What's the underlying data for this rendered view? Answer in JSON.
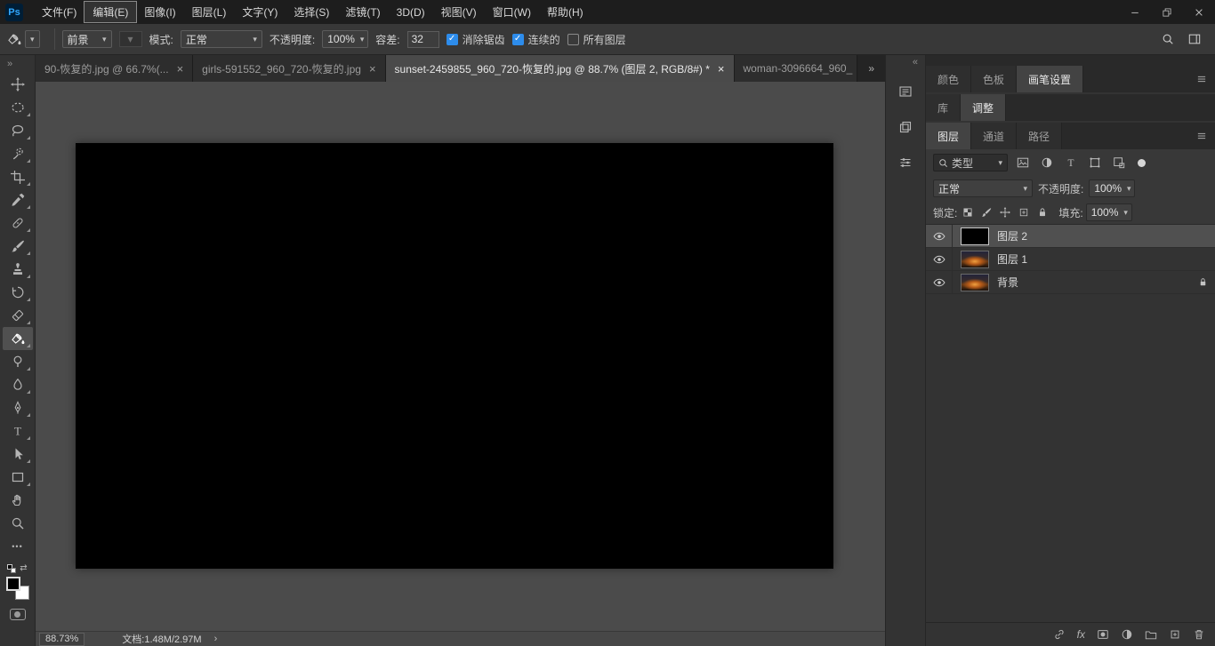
{
  "window": {
    "logo": "Ps"
  },
  "glyphs": {
    "close": "×",
    "chevron_down": "▾",
    "overflow_right": "»",
    "collapse_left": "«",
    "status_chevron": "›",
    "check": "✓",
    "ellipsis": "•••",
    "swap": "⇄"
  },
  "menu_bar": {
    "items": [
      "文件(F)",
      "编辑(E)",
      "图像(I)",
      "图层(L)",
      "文字(Y)",
      "选择(S)",
      "滤镜(T)",
      "3D(D)",
      "视图(V)",
      "窗口(W)",
      "帮助(H)"
    ]
  },
  "options_bar": {
    "tool": "paint-bucket-tool",
    "foreground_source": "前景",
    "mode_label": "模式:",
    "mode_value": "正常",
    "opacity_label": "不透明度:",
    "opacity_value": "100%",
    "tolerance_label": "容差:",
    "tolerance_value": "32",
    "anti_alias_label": "消除锯齿",
    "anti_alias_checked": true,
    "contiguous_label": "连续的",
    "contiguous_checked": true,
    "all_layers_label": "所有图层",
    "all_layers_checked": false
  },
  "document_tabs": [
    {
      "title": "90-恢复的.jpg @ 66.7%(...",
      "active": false
    },
    {
      "title": "girls-591552_960_720-恢复的.jpg",
      "active": false
    },
    {
      "title": "sunset-2459855_960_720-恢复的.jpg @ 88.7% (图层 2, RGB/8#) *",
      "active": true
    },
    {
      "title": "woman-3096664_960_",
      "active": false
    }
  ],
  "toolbar_tools": [
    {
      "name": "move-tool",
      "selected": false
    },
    {
      "name": "elliptical-marquee-tool",
      "selected": false
    },
    {
      "name": "lasso-tool",
      "selected": false
    },
    {
      "name": "quick-selection-tool",
      "selected": false
    },
    {
      "name": "crop-tool",
      "selected": false
    },
    {
      "name": "eyedropper-tool",
      "selected": false
    },
    {
      "name": "spot-healing-brush-tool",
      "selected": false
    },
    {
      "name": "brush-tool",
      "selected": false
    },
    {
      "name": "clone-stamp-tool",
      "selected": false
    },
    {
      "name": "history-brush-tool",
      "selected": false
    },
    {
      "name": "eraser-tool",
      "selected": false
    },
    {
      "name": "paint-bucket-tool",
      "selected": true
    },
    {
      "name": "dodge-tool",
      "selected": false
    },
    {
      "name": "blur-tool",
      "selected": false
    },
    {
      "name": "pen-tool",
      "selected": false
    },
    {
      "name": "type-tool",
      "selected": false
    },
    {
      "name": "path-selection-tool",
      "selected": false
    },
    {
      "name": "rectangle-tool",
      "selected": false
    },
    {
      "name": "hand-tool",
      "selected": false
    },
    {
      "name": "zoom-tool",
      "selected": false
    },
    {
      "name": "edit-toolbar",
      "selected": false
    }
  ],
  "status_bar": {
    "zoom": "88.73%",
    "doc_label": "文档:1.48M/2.97M"
  },
  "panels": {
    "group1_tabs": [
      "颜色",
      "色板",
      "画笔设置"
    ],
    "group2_tabs": [
      "库",
      "调整"
    ],
    "layers_group_tabs": [
      "图层",
      "通道",
      "路径"
    ],
    "filter_type": "类型",
    "blend_mode": "正常",
    "opacity_label": "不透明度:",
    "opacity_value": "100%",
    "lock_label": "锁定:",
    "fill_label": "填充:",
    "fill_value": "100%",
    "fx_label": "fx",
    "layers": [
      {
        "name": "图层 2",
        "selected": true,
        "thumb": "black",
        "locked": false
      },
      {
        "name": "图层 1",
        "selected": false,
        "thumb": "sunset",
        "locked": false
      },
      {
        "name": "背景",
        "selected": false,
        "thumb": "sunset",
        "locked": true
      }
    ]
  },
  "colors": {
    "logo_blue": "#31a8ff",
    "checkbox_blue": "#2d8ceb",
    "canvas_fill": "#000000",
    "workspace_gray": "#4b4b4b"
  }
}
